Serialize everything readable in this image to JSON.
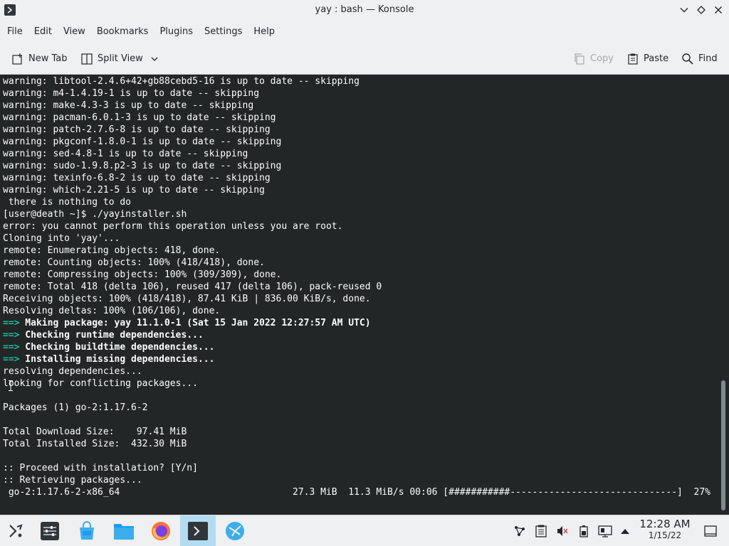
{
  "window": {
    "title": "yay : bash — Konsole"
  },
  "menu": [
    "File",
    "Edit",
    "View",
    "Bookmarks",
    "Plugins",
    "Settings",
    "Help"
  ],
  "toolbar": {
    "new_tab": "New Tab",
    "split_view": "Split View",
    "copy": "Copy",
    "paste": "Paste",
    "find": "Find"
  },
  "terminal": {
    "lines": [
      {
        "text": "warning: libtool-2.4.6+42+gb88cebd5-16 is up to date -- skipping"
      },
      {
        "text": "warning: m4-1.4.19-1 is up to date -- skipping"
      },
      {
        "text": "warning: make-4.3-3 is up to date -- skipping"
      },
      {
        "text": "warning: pacman-6.0.1-3 is up to date -- skipping"
      },
      {
        "text": "warning: patch-2.7.6-8 is up to date -- skipping"
      },
      {
        "text": "warning: pkgconf-1.8.0-1 is up to date -- skipping"
      },
      {
        "text": "warning: sed-4.8-1 is up to date -- skipping"
      },
      {
        "text": "warning: sudo-1.9.8.p2-3 is up to date -- skipping"
      },
      {
        "text": "warning: texinfo-6.8-2 is up to date -- skipping"
      },
      {
        "text": "warning: which-2.21-5 is up to date -- skipping"
      },
      {
        "text": " there is nothing to do"
      },
      {
        "text": "[user@death ~]$ ./yayinstaller.sh"
      },
      {
        "text": "error: you cannot perform this operation unless you are root."
      },
      {
        "text": "Cloning into 'yay'..."
      },
      {
        "text": "remote: Enumerating objects: 418, done."
      },
      {
        "text": "remote: Counting objects: 100% (418/418), done."
      },
      {
        "text": "remote: Compressing objects: 100% (309/309), done."
      },
      {
        "text": "remote: Total 418 (delta 106), reused 417 (delta 106), pack-reused 0"
      },
      {
        "text": "Receiving objects: 100% (418/418), 87.41 KiB | 836.00 KiB/s, done."
      },
      {
        "text": "Resolving deltas: 100% (106/106), done."
      },
      {
        "arrow": "==>",
        "text": " Making package: yay 11.1.0-1 (Sat 15 Jan 2022 12:27:57 AM UTC)"
      },
      {
        "arrow": "==>",
        "text": " Checking runtime dependencies..."
      },
      {
        "arrow": "==>",
        "text": " Checking buildtime dependencies..."
      },
      {
        "arrow": "==>",
        "text": " Installing missing dependencies..."
      },
      {
        "text": "resolving dependencies..."
      },
      {
        "text": "looking for conflicting packages..."
      },
      {
        "text": ""
      },
      {
        "text": "Packages (1) go-2:1.17.6-2"
      },
      {
        "text": ""
      },
      {
        "text": "Total Download Size:    97.41 MiB"
      },
      {
        "text": "Total Installed Size:  432.30 MiB"
      },
      {
        "text": ""
      },
      {
        "text": ":: Proceed with installation? [Y/n]"
      },
      {
        "text": ":: Retrieving packages..."
      },
      {
        "text": " go-2:1.17.6-2-x86_64                               27.3 MiB  11.3 MiB/s 00:06 [###########------------------------------]  27%"
      }
    ]
  },
  "taskbar": {
    "clock_time": "12:28 AM",
    "clock_date": "1/15/22"
  },
  "colors": {
    "terminal_bg": "#232627",
    "terminal_fg": "#fcfcfc",
    "arrow": "#1abc9c",
    "chrome": "#eff0f1",
    "active_task": "#b3dcf1"
  }
}
